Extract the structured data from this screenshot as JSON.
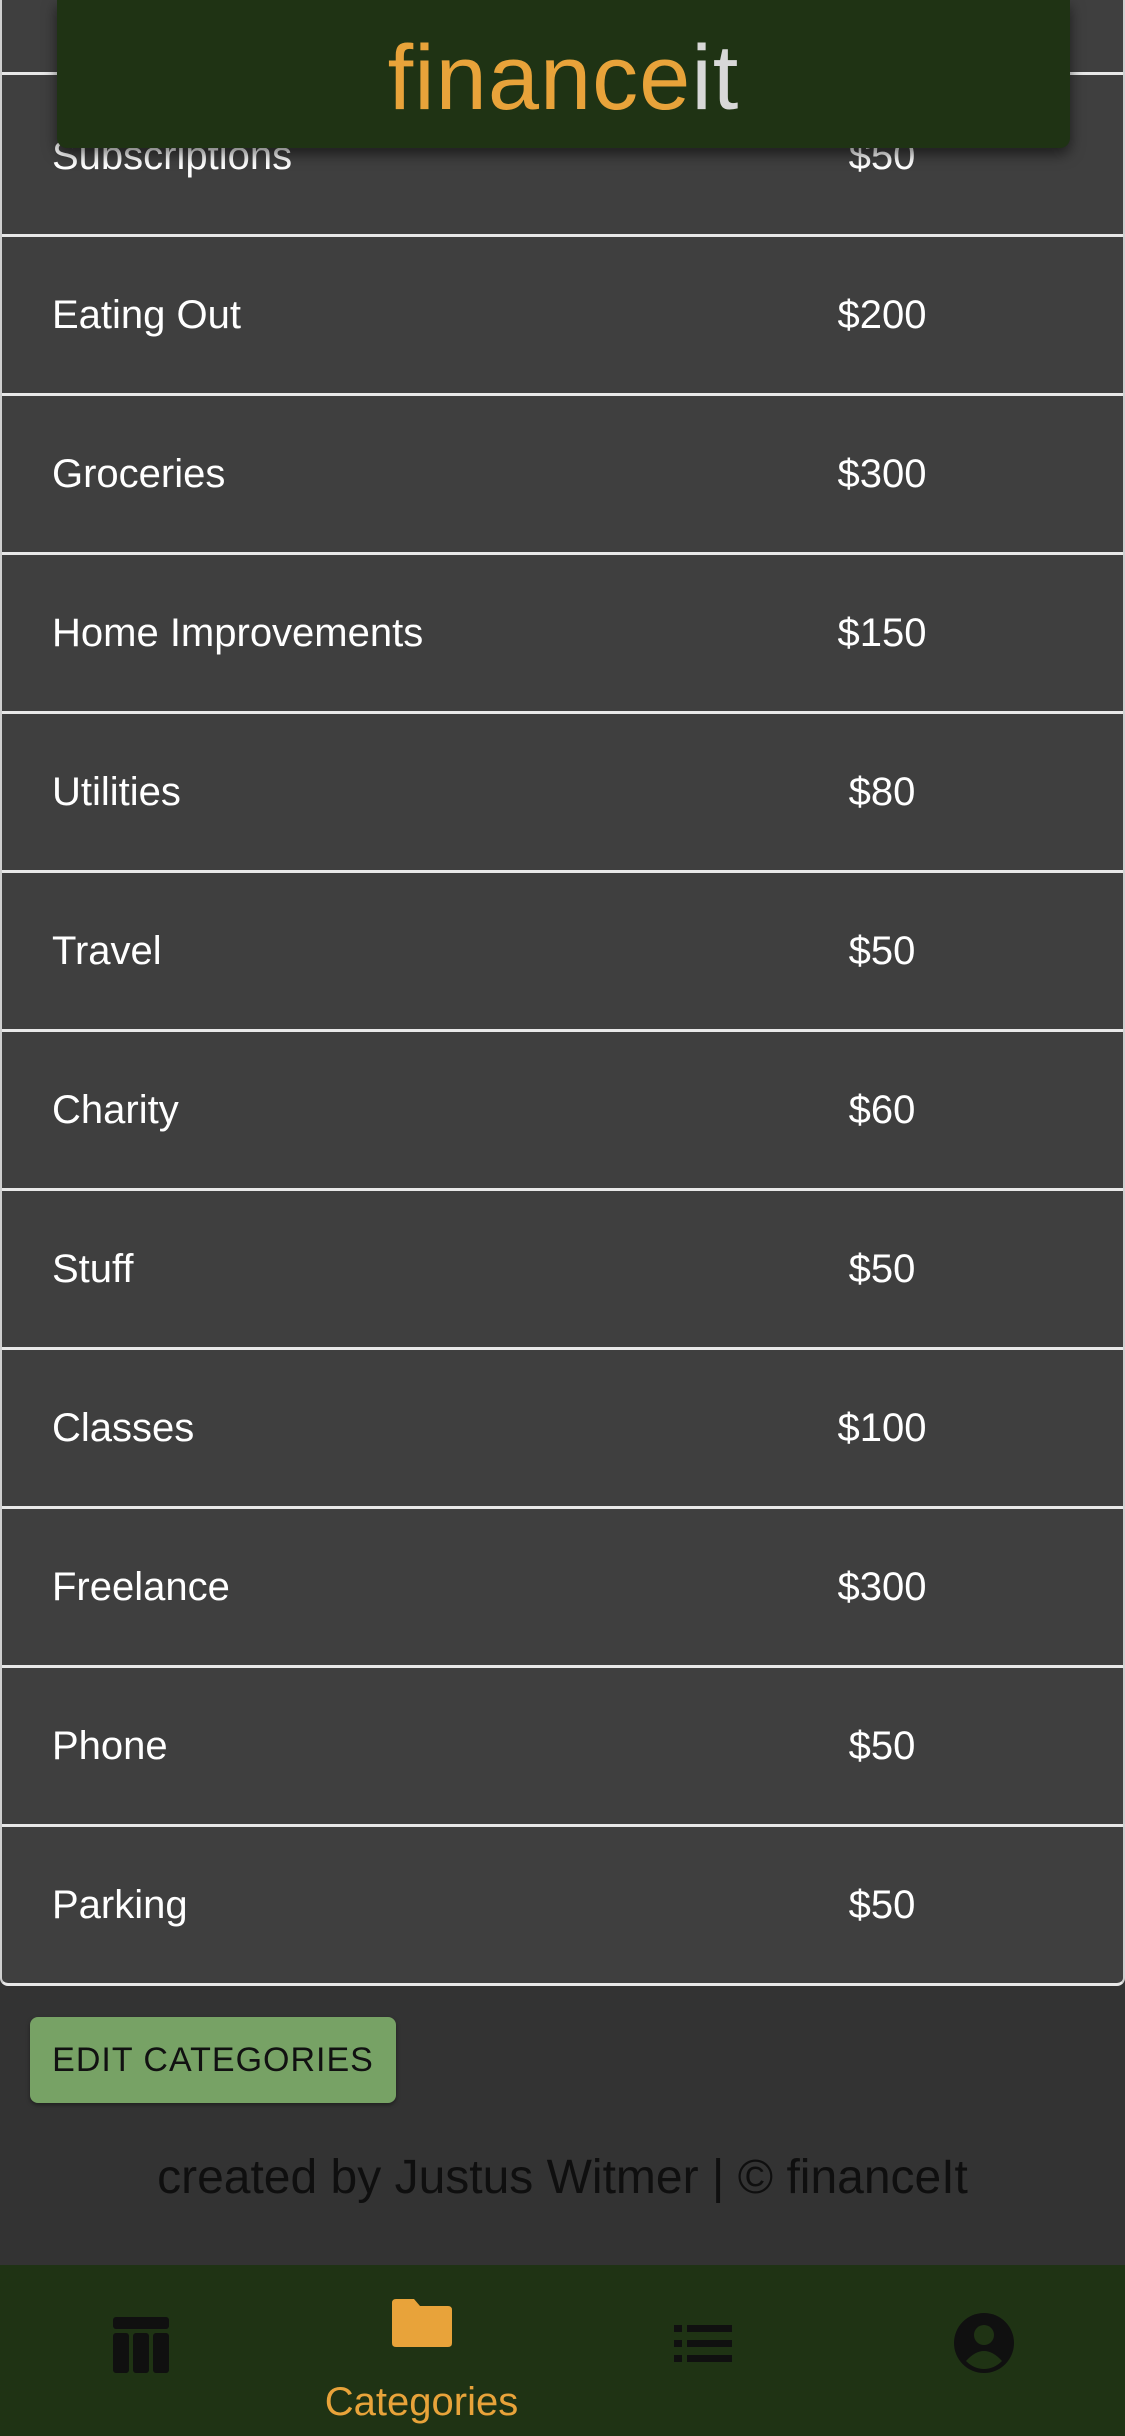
{
  "app": {
    "logo_part1": "finance",
    "logo_part2": "it"
  },
  "categories": [
    {
      "name": "Subscriptions",
      "amount": "$50"
    },
    {
      "name": "Eating Out",
      "amount": "$200"
    },
    {
      "name": "Groceries",
      "amount": "$300"
    },
    {
      "name": "Home Improvements",
      "amount": "$150"
    },
    {
      "name": "Utilities",
      "amount": "$80"
    },
    {
      "name": "Travel",
      "amount": "$50"
    },
    {
      "name": "Charity",
      "amount": "$60"
    },
    {
      "name": "Stuff",
      "amount": "$50"
    },
    {
      "name": "Classes",
      "amount": "$100"
    },
    {
      "name": "Freelance",
      "amount": "$300"
    },
    {
      "name": "Phone",
      "amount": "$50"
    },
    {
      "name": "Parking",
      "amount": "$50"
    }
  ],
  "edit_button_label": "EDIT CATEGORIES",
  "footer": {
    "credit": "created by Justus Witmer | © financeIt"
  },
  "nav": {
    "items": [
      {
        "icon": "table-icon",
        "label": ""
      },
      {
        "icon": "folder-icon",
        "label": "Categories",
        "active": true
      },
      {
        "icon": "list-icon",
        "label": ""
      },
      {
        "icon": "account-icon",
        "label": ""
      }
    ]
  },
  "colors": {
    "header_bg": "#1f3314",
    "accent": "#e8a33a",
    "button_bg": "#77a265",
    "row_bg": "#3f3f3f",
    "page_bg": "#333333"
  }
}
